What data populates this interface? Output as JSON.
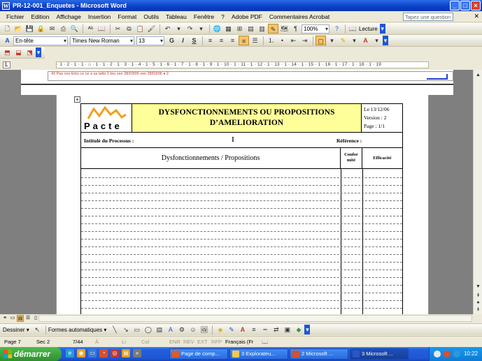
{
  "window": {
    "title": "PR-12-001_Enquetes - Microsoft Word",
    "app_icon": "W",
    "buttons": [
      "_",
      "□",
      "×"
    ]
  },
  "menu": {
    "items": [
      "Fichier",
      "Edition",
      "Affichage",
      "Insertion",
      "Format",
      "Outils",
      "Tableau",
      "Fenêtre",
      "?",
      "Adobe PDF",
      "Commentaires Acrobat"
    ],
    "ask_placeholder": "Tapez une question"
  },
  "toolbar": {
    "zoom": "100%",
    "lecture_label": "Lecture",
    "style": "En-tête",
    "font": "Times New Roman",
    "size": "13",
    "bold": "G",
    "italic": "I",
    "shadow": "S"
  },
  "ruler": {
    "text": "· 1 · 2 · 1 · 1 · ⌂ · 1 · 1 · 2 · 1 · 3 · 1 · 4 · 1 · 5 · 1 · 6 · 1 · 7 · 1 · 8 · 1 · 9 · 1 · 10 · 1 · 11 · 1 · 12 · 1 · 13 · 1 · 14 · 1 · 15 · 1 · 16 · 1 · 17 · 1 · 18 · 1 · 19"
  },
  "document": {
    "previous_row_text": "43        Pas ces ticks ce ce a sa tatto              1 tou     ven 28/03/06   ven 28/03/06 ♦ 2",
    "logo_text": "Pacte",
    "title_line1": "DYSFONCTIONNEMENTS OU PROPOSITIONS",
    "title_line2": "D’AMELIORATION",
    "meta_date": "Le 13/12/06",
    "meta_version": "Version : 2",
    "meta_page": "Page : 1/1",
    "process_label": "Intitulé du Processus :",
    "reference_label": "Référence :",
    "col1": "Dysfonctionnements / Propositions",
    "col2_line1": "Confor",
    "col2_line2": "mité",
    "col3": "Efficacité",
    "logo_color": "#f0a020"
  },
  "drawing": {
    "draw_label": "Dessiner ▾",
    "autoshapes_label": "Formes automatiques ▾"
  },
  "status": {
    "page": "Page 7",
    "section": "Sec 2",
    "pages": "7/44",
    "at": "À",
    "line": "Li",
    "col": "Col",
    "enr": "ENR",
    "rev": "REV",
    "ext": "EXT",
    "rfp": "RFP",
    "lang": "Français (Fr"
  },
  "taskbar": {
    "start_label": "démarrer",
    "tasks": [
      {
        "label": "Page de comp...",
        "color": "#e05a2a"
      },
      {
        "label": "3 Explorateu...",
        "color": "#f2c94c"
      },
      {
        "label": "2 Microsoft ...",
        "color": "#d94f2b"
      },
      {
        "label": "3 Microsoft ...",
        "color": "#2b55c8"
      }
    ],
    "clock": "10:22"
  }
}
